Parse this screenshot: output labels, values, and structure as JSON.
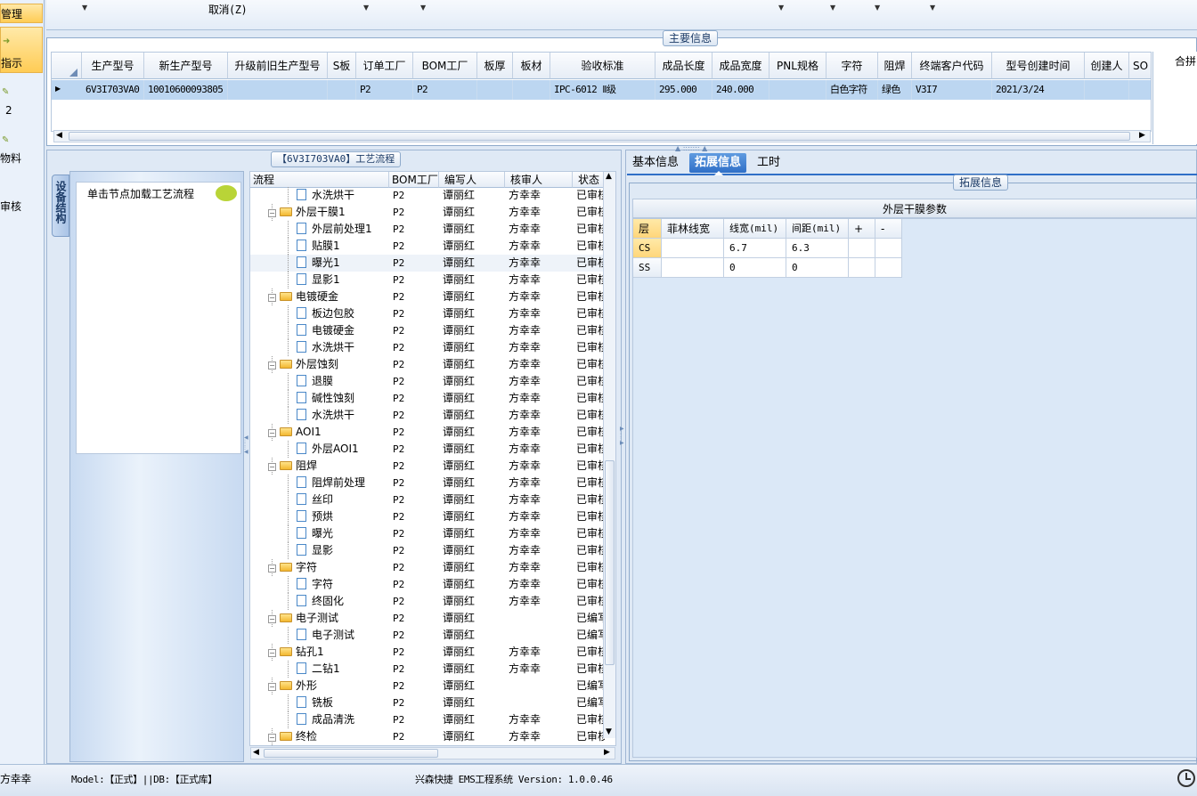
{
  "leftnav": {
    "items": [
      {
        "label": "管理",
        "selected": true
      },
      {
        "label": "指示",
        "selected": true
      },
      {
        "label": "2",
        "selected": false
      },
      {
        "label": "物料",
        "selected": false
      },
      {
        "label": "审核",
        "selected": false
      }
    ]
  },
  "toolbar": {
    "cancel_label": "取消(Z)"
  },
  "main_info": {
    "title": "主要信息",
    "columns": [
      "生产型号",
      "新生产型号",
      "升级前旧生产型号",
      "S板",
      "订单工厂",
      "BOM工厂",
      "板厚",
      "板材",
      "验收标准",
      "成品长度",
      "成品宽度",
      "PNL规格",
      "字符",
      "阻焊",
      "终端客户代码",
      "型号创建时间",
      "创建人",
      "SO"
    ],
    "row": [
      "6V3I703VA0",
      "10010600093805",
      "",
      "",
      "P2",
      "P2",
      "",
      "",
      "IPC-6012 Ⅱ级",
      "295.000",
      "240.000",
      "",
      "白色字符",
      "绿色",
      "V3I7",
      "2021/3/24",
      "",
      ""
    ],
    "right_label": "合拼"
  },
  "process": {
    "title": "【6V3I703VA0】工艺流程",
    "side_tab": "设备结构",
    "load_hint": "单击节点加载工艺流程",
    "columns": [
      "流程",
      "BOM工厂",
      "编写人",
      "核审人",
      "状态"
    ],
    "rows": [
      {
        "level": 2,
        "name": "水洗烘干",
        "bom": "P2",
        "author": "谭丽红",
        "reviewer": "方幸幸",
        "status": "已审核"
      },
      {
        "level": 1,
        "name": "外层干膜1",
        "bom": "P2",
        "author": "谭丽红",
        "reviewer": "方幸幸",
        "status": "已审核"
      },
      {
        "level": 2,
        "name": "外层前处理1",
        "bom": "P2",
        "author": "谭丽红",
        "reviewer": "方幸幸",
        "status": "已审核"
      },
      {
        "level": 2,
        "name": "贴膜1",
        "bom": "P2",
        "author": "谭丽红",
        "reviewer": "方幸幸",
        "status": "已审核"
      },
      {
        "level": 2,
        "name": "曝光1",
        "bom": "P2",
        "author": "谭丽红",
        "reviewer": "方幸幸",
        "status": "已审核",
        "selected": true
      },
      {
        "level": 2,
        "name": "显影1",
        "bom": "P2",
        "author": "谭丽红",
        "reviewer": "方幸幸",
        "status": "已审核"
      },
      {
        "level": 1,
        "name": "电镀硬金",
        "bom": "P2",
        "author": "谭丽红",
        "reviewer": "方幸幸",
        "status": "已审核"
      },
      {
        "level": 2,
        "name": "板边包胶",
        "bom": "P2",
        "author": "谭丽红",
        "reviewer": "方幸幸",
        "status": "已审核"
      },
      {
        "level": 2,
        "name": "电镀硬金",
        "bom": "P2",
        "author": "谭丽红",
        "reviewer": "方幸幸",
        "status": "已审核"
      },
      {
        "level": 2,
        "name": "水洗烘干",
        "bom": "P2",
        "author": "谭丽红",
        "reviewer": "方幸幸",
        "status": "已审核"
      },
      {
        "level": 1,
        "name": "外层蚀刻",
        "bom": "P2",
        "author": "谭丽红",
        "reviewer": "方幸幸",
        "status": "已审核"
      },
      {
        "level": 2,
        "name": "退膜",
        "bom": "P2",
        "author": "谭丽红",
        "reviewer": "方幸幸",
        "status": "已审核"
      },
      {
        "level": 2,
        "name": "碱性蚀刻",
        "bom": "P2",
        "author": "谭丽红",
        "reviewer": "方幸幸",
        "status": "已审核"
      },
      {
        "level": 2,
        "name": "水洗烘干",
        "bom": "P2",
        "author": "谭丽红",
        "reviewer": "方幸幸",
        "status": "已审核"
      },
      {
        "level": 1,
        "name": "AOI1",
        "bom": "P2",
        "author": "谭丽红",
        "reviewer": "方幸幸",
        "status": "已审核"
      },
      {
        "level": 2,
        "name": "外层AOI1",
        "bom": "P2",
        "author": "谭丽红",
        "reviewer": "方幸幸",
        "status": "已审核"
      },
      {
        "level": 1,
        "name": "阻焊",
        "bom": "P2",
        "author": "谭丽红",
        "reviewer": "方幸幸",
        "status": "已审核"
      },
      {
        "level": 2,
        "name": "阻焊前处理",
        "bom": "P2",
        "author": "谭丽红",
        "reviewer": "方幸幸",
        "status": "已审核"
      },
      {
        "level": 2,
        "name": "丝印",
        "bom": "P2",
        "author": "谭丽红",
        "reviewer": "方幸幸",
        "status": "已审核"
      },
      {
        "level": 2,
        "name": "预烘",
        "bom": "P2",
        "author": "谭丽红",
        "reviewer": "方幸幸",
        "status": "已审核"
      },
      {
        "level": 2,
        "name": "曝光",
        "bom": "P2",
        "author": "谭丽红",
        "reviewer": "方幸幸",
        "status": "已审核"
      },
      {
        "level": 2,
        "name": "显影",
        "bom": "P2",
        "author": "谭丽红",
        "reviewer": "方幸幸",
        "status": "已审核"
      },
      {
        "level": 1,
        "name": "字符",
        "bom": "P2",
        "author": "谭丽红",
        "reviewer": "方幸幸",
        "status": "已审核"
      },
      {
        "level": 2,
        "name": "字符",
        "bom": "P2",
        "author": "谭丽红",
        "reviewer": "方幸幸",
        "status": "已审核"
      },
      {
        "level": 2,
        "name": "终固化",
        "bom": "P2",
        "author": "谭丽红",
        "reviewer": "方幸幸",
        "status": "已审核"
      },
      {
        "level": 1,
        "name": "电子测试",
        "bom": "P2",
        "author": "谭丽红",
        "reviewer": "",
        "status": "已编写"
      },
      {
        "level": 2,
        "name": "电子测试",
        "bom": "P2",
        "author": "谭丽红",
        "reviewer": "",
        "status": "已编写"
      },
      {
        "level": 1,
        "name": "钻孔1",
        "bom": "P2",
        "author": "谭丽红",
        "reviewer": "方幸幸",
        "status": "已审核"
      },
      {
        "level": 2,
        "name": "二钻1",
        "bom": "P2",
        "author": "谭丽红",
        "reviewer": "方幸幸",
        "status": "已审核"
      },
      {
        "level": 1,
        "name": "外形",
        "bom": "P2",
        "author": "谭丽红",
        "reviewer": "",
        "status": "已编写"
      },
      {
        "level": 2,
        "name": "铣板",
        "bom": "P2",
        "author": "谭丽红",
        "reviewer": "",
        "status": "已编写"
      },
      {
        "level": 2,
        "name": "成品清洗",
        "bom": "P2",
        "author": "谭丽红",
        "reviewer": "方幸幸",
        "status": "已审核"
      },
      {
        "level": 1,
        "name": "终检",
        "bom": "P2",
        "author": "谭丽红",
        "reviewer": "方幸幸",
        "status": "已审核"
      }
    ]
  },
  "tabs": [
    {
      "label": "基本信息",
      "active": false
    },
    {
      "label": "拓展信息",
      "active": true
    },
    {
      "label": "工时",
      "active": false
    }
  ],
  "ext_info": {
    "title": "拓展信息",
    "table_title": "外层干膜参数",
    "headers": [
      "层",
      "菲林线宽",
      "线宽(mil)",
      "间距(mil)",
      "+",
      "-"
    ],
    "rows": [
      [
        "CS",
        "",
        "6.7",
        "6.3",
        "",
        ""
      ],
      [
        "SS",
        "",
        "0",
        "0",
        "",
        ""
      ]
    ]
  },
  "statusbar": {
    "user": "方幸幸",
    "model": "Model:【正式】||DB:【正式库】",
    "system": "兴森快捷 EMS工程系统 Version: 1.0.0.46"
  }
}
